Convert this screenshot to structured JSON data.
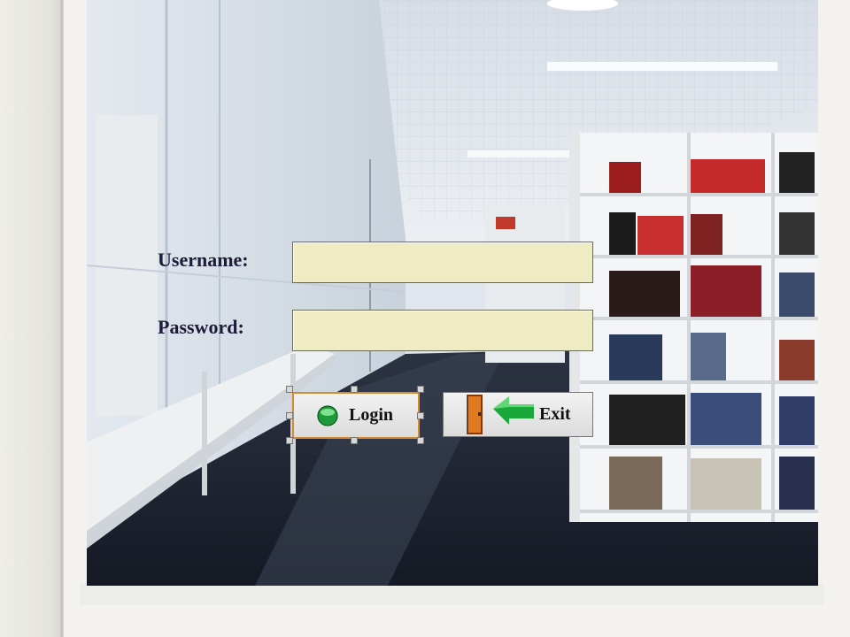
{
  "form": {
    "username_label": "Username:",
    "password_label": "Password:",
    "username_value": "",
    "password_value": "",
    "login_label": "Login",
    "exit_label": "Exit"
  },
  "icons": {
    "login": "green-globe-icon",
    "exit": "exit-door-arrow-icon"
  },
  "colors": {
    "field_background": "#efecc4",
    "label_text": "#1d1a3a",
    "login_focus_border": "#d48a30",
    "exit_arrow": "#1aa83a"
  }
}
